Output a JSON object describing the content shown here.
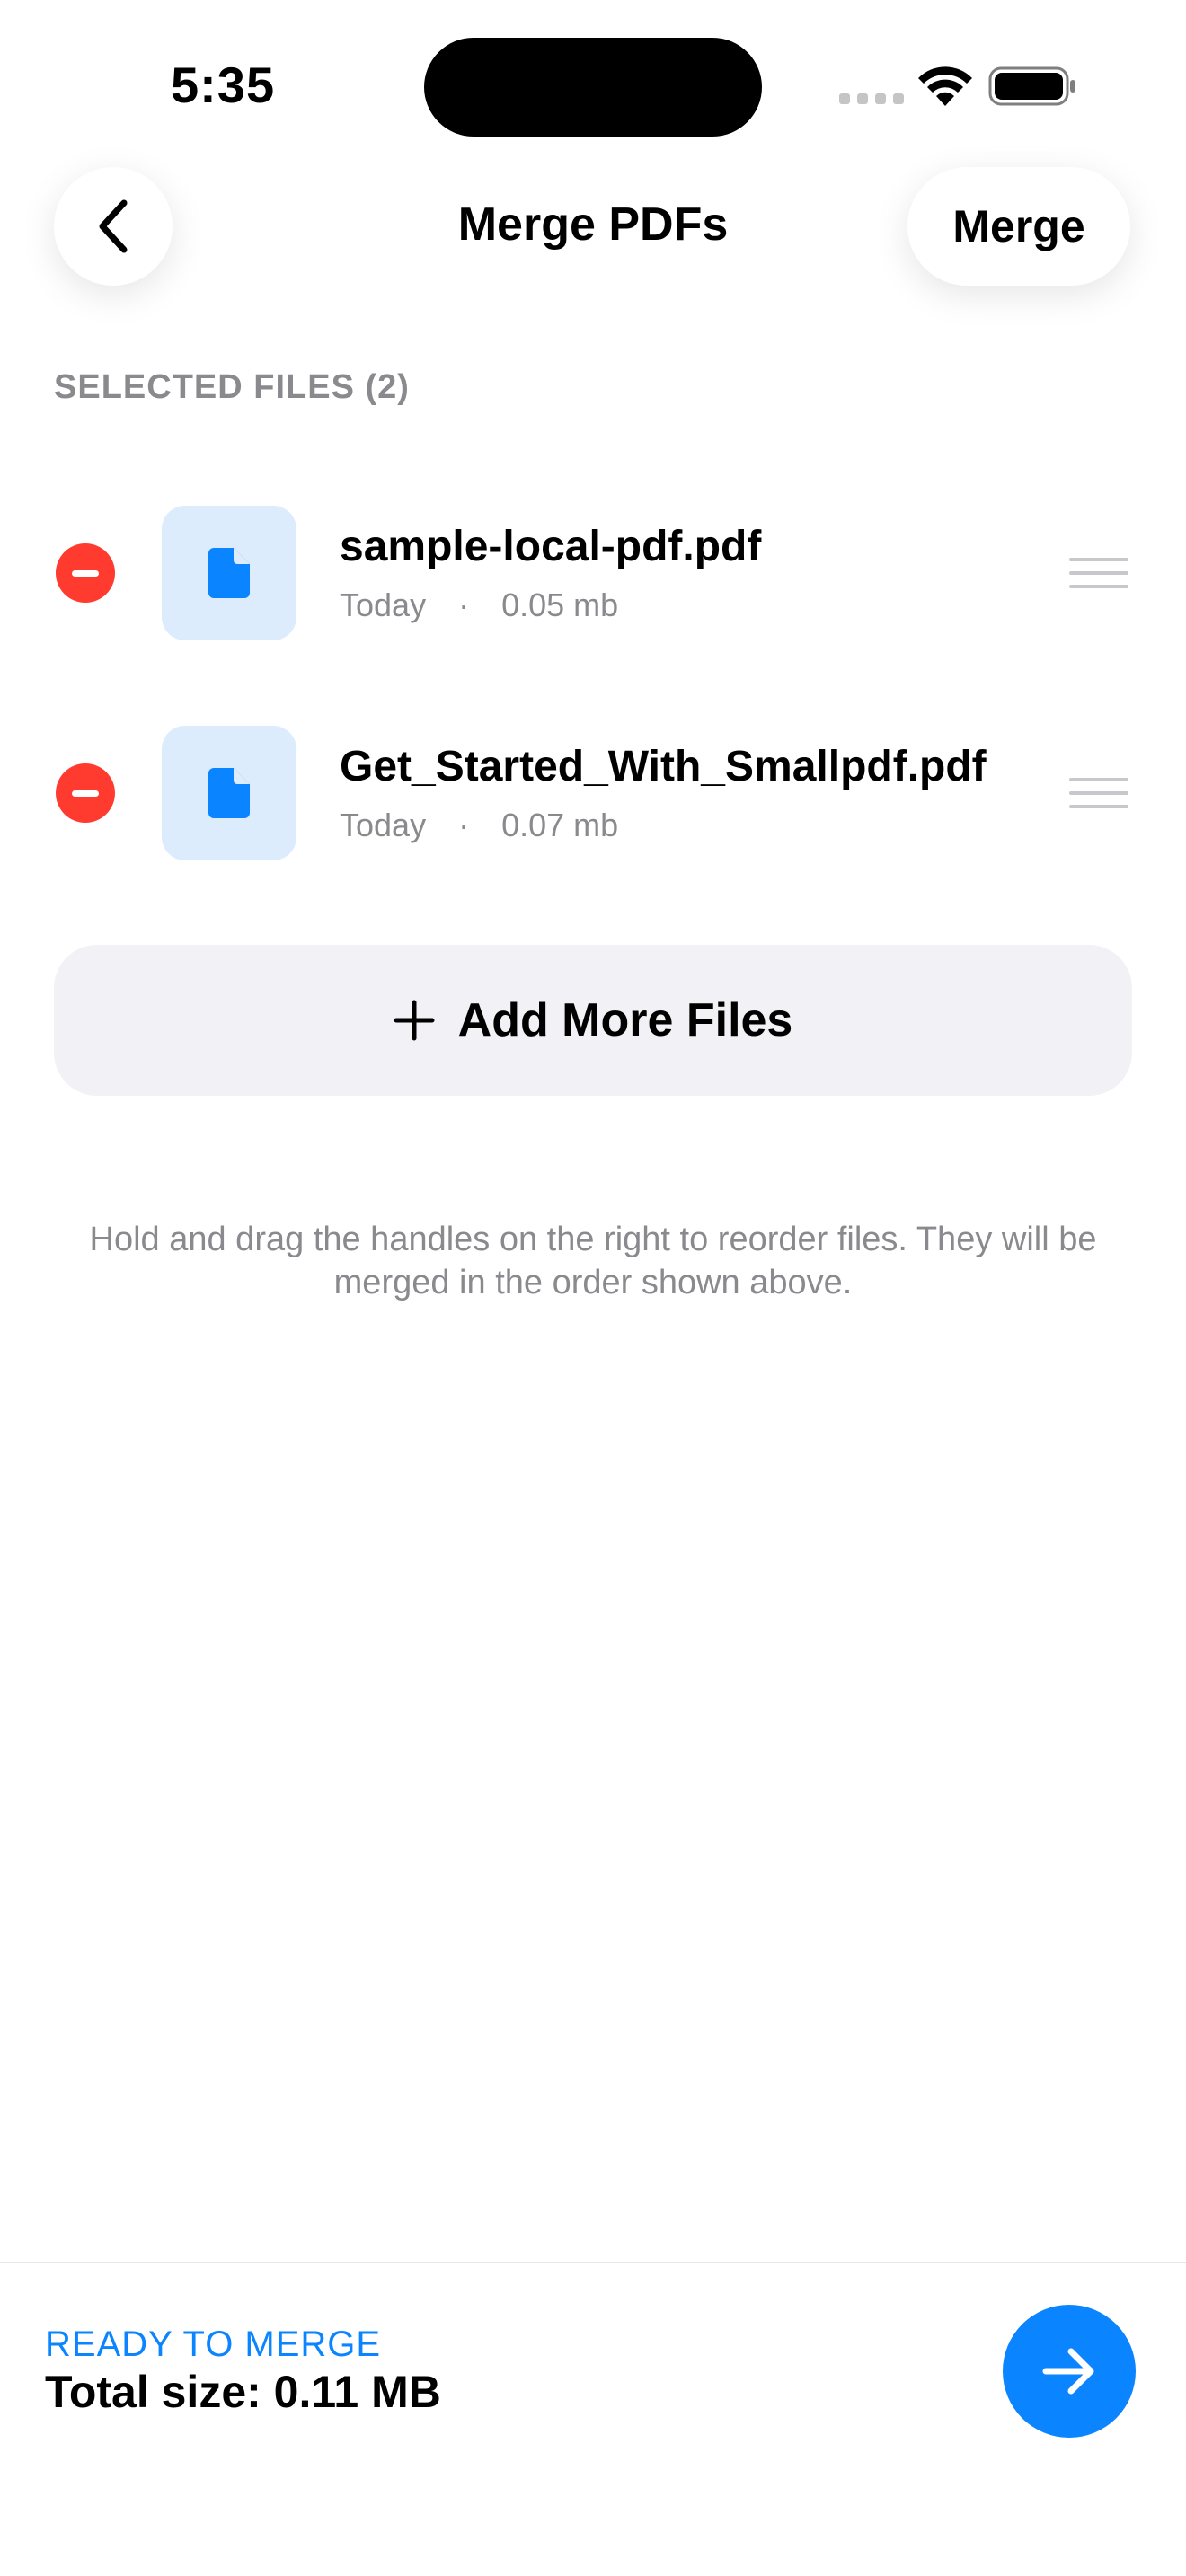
{
  "status_bar": {
    "time": "5:35"
  },
  "nav": {
    "title": "Merge PDFs",
    "merge_label": "Merge"
  },
  "section": {
    "label": "SELECTED FILES (2)"
  },
  "files": [
    {
      "name": "sample-local-pdf.pdf",
      "date": "Today",
      "separator": "·",
      "size": "0.05 mb"
    },
    {
      "name": "Get_Started_With_Smallpdf.pdf",
      "date": "Today",
      "separator": "·",
      "size": "0.07 mb"
    }
  ],
  "add_files": {
    "label": "Add More Files"
  },
  "hint": {
    "text": "Hold and drag the handles on the right to reorder files. They will be merged in the order shown above."
  },
  "footer": {
    "status": "READY TO MERGE",
    "total": "Total size: 0.11 MB"
  },
  "colors": {
    "accent": "#0a84ff",
    "destructive": "#ff3b30",
    "thumb_bg": "#dcecfd",
    "secondary_text": "#8a8a8e"
  },
  "icons": {
    "back": "chevron-left-icon",
    "remove": "minus-circle-icon",
    "file": "document-icon",
    "drag": "drag-handle-icon",
    "add": "plus-icon",
    "next": "arrow-right-icon"
  }
}
